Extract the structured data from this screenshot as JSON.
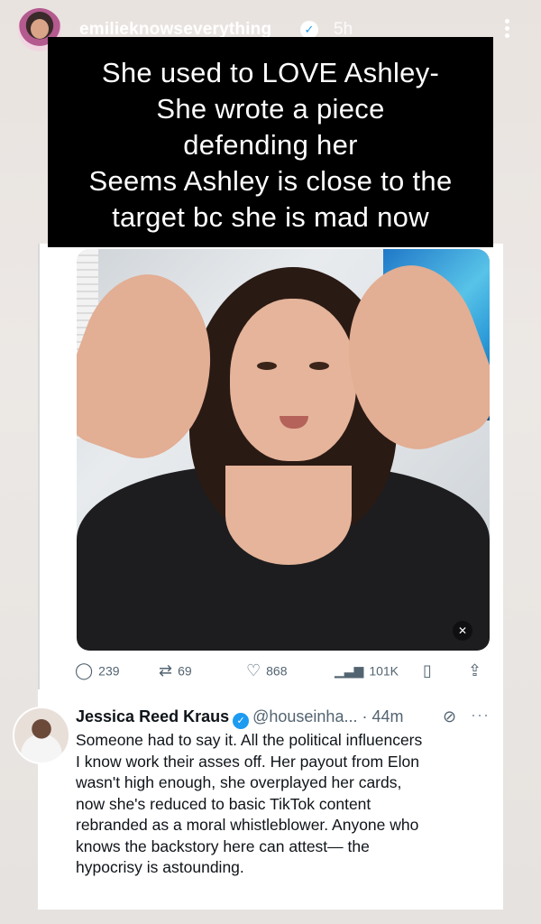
{
  "story": {
    "username": "emilieknowseverything",
    "time": "5h"
  },
  "caption": {
    "lines": [
      "She used to LOVE Ashley-",
      "She wrote a piece",
      "defending her",
      "Seems Ashley is close to the",
      "target bc she is mad now"
    ]
  },
  "post": {
    "stats": {
      "replies": "239",
      "reposts": "69",
      "likes": "868",
      "views": "101K"
    }
  },
  "tweet": {
    "name": "Jessica Reed Kraus",
    "handle": "@houseinha...",
    "time": "· 44m",
    "lines": [
      "Someone had to say it. All the political influencers",
      "I know work their asses off. Her payout from Elon",
      "wasn't high enough, she overplayed her cards,",
      "now she's reduced to basic TikTok content",
      "rebranded as a moral whistleblower. Anyone who",
      "knows the backstory here can attest— the",
      "hypocrisy is astounding."
    ]
  },
  "colors": {
    "x_blue": "#1d9bf0",
    "muted_text": "#536471",
    "caption_bg": "#000000"
  },
  "icons": [
    "verified-icon",
    "more-icon",
    "reply-icon",
    "repost-icon",
    "like-icon",
    "views-icon",
    "bookmark-icon",
    "share-icon",
    "mute-icon",
    "grok-icon"
  ]
}
